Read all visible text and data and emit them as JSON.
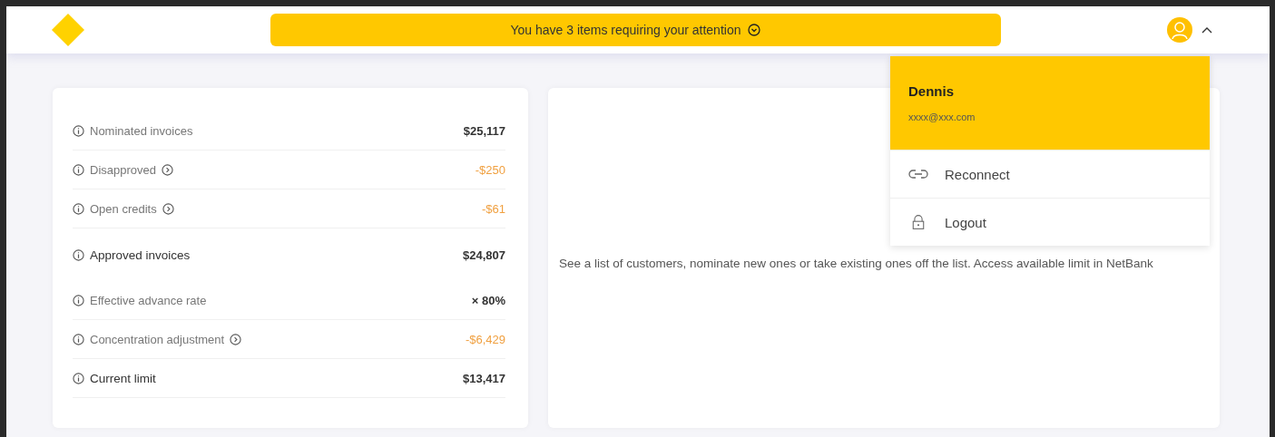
{
  "header": {
    "alert": "You have 3 items requiring your attention",
    "user_menu": {
      "expanded": true
    }
  },
  "summary": {
    "rows": [
      {
        "label": "Nominated invoices",
        "value": "$25,117",
        "kind": "item",
        "negative": false,
        "has_details": false
      },
      {
        "label": "Disapproved",
        "value": "-$250",
        "kind": "item",
        "negative": true,
        "has_details": true
      },
      {
        "label": "Open credits",
        "value": "-$61",
        "kind": "item",
        "negative": true,
        "has_details": true
      },
      {
        "label": "Approved invoices",
        "value": "$24,807",
        "kind": "total",
        "negative": false,
        "has_details": false
      },
      {
        "label": "Effective advance rate",
        "value": "× 80%",
        "kind": "item",
        "negative": false,
        "has_details": false
      },
      {
        "label": "Concentration adjustment",
        "value": "-$6,429",
        "kind": "item",
        "negative": true,
        "has_details": true
      },
      {
        "label": "Current limit",
        "value": "$13,417",
        "kind": "total",
        "negative": false,
        "has_details": false
      }
    ]
  },
  "customers_card": {
    "description": "See a list of customers, nominate new ones or take existing ones off the list. Access available limit in NetBank"
  },
  "dropdown": {
    "name": "Dennis",
    "email": "xxxx@xxx.com",
    "items": [
      {
        "label": "Reconnect",
        "kind": "link"
      },
      {
        "label": "Logout",
        "kind": "lock"
      }
    ]
  }
}
